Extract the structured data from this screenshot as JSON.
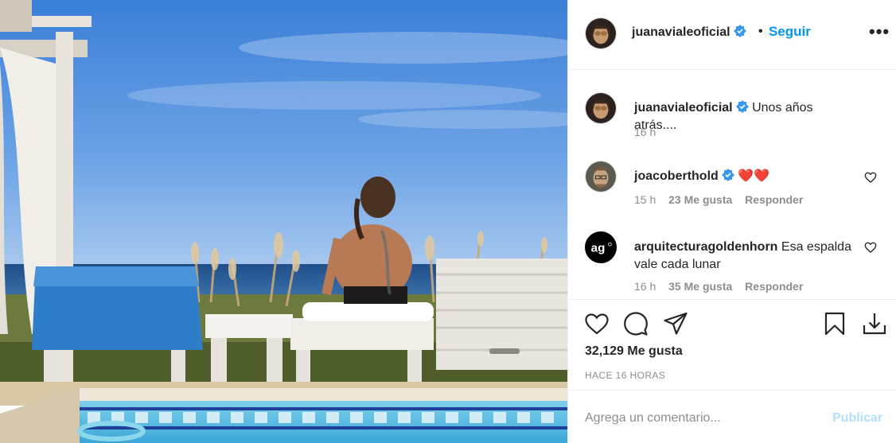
{
  "post": {
    "author": "juanavialeoficial",
    "follow_label": "Seguir",
    "separator": "•",
    "more_label": "•••"
  },
  "comments": [
    {
      "user": "juanavialeoficial",
      "text": "Unos años atrás....",
      "time": "16 h",
      "verified": true
    },
    {
      "user": "joacoberthold",
      "text": "❤️❤️",
      "time": "15 h",
      "likes": "23 Me gusta",
      "reply": "Responder",
      "verified": true
    },
    {
      "user": "arquitecturagoldenhorn",
      "text": "Esa espalda vale cada lunar",
      "time": "16 h",
      "likes": "35 Me gusta",
      "reply": "Responder",
      "avatar_text": "ag"
    }
  ],
  "stats": {
    "likes": "32,129 Me gusta",
    "time_ago": "HACE 16 HORAS"
  },
  "add_comment": {
    "placeholder": "Agrega un comentario...",
    "publish_label": "Publicar"
  },
  "icons": {
    "like": "heart-icon",
    "comment": "comment-icon",
    "share": "share-icon",
    "save": "bookmark-icon",
    "download": "download-icon"
  },
  "colors": {
    "link_blue": "#0095f6",
    "publish_disabled": "#b2dffc",
    "verified_blue": "#3897f0",
    "text_dark": "#262626",
    "text_muted": "#8e8e8e"
  }
}
